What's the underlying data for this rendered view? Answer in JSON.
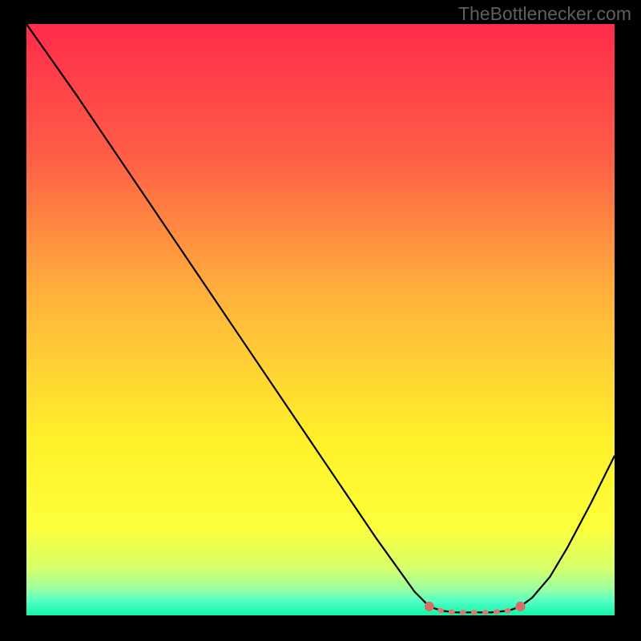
{
  "watermark": "TheBottlenecker.com",
  "chart_data": {
    "type": "line",
    "title": "",
    "xlabel": "",
    "ylabel": "",
    "xlim": [
      0,
      100
    ],
    "ylim": [
      0,
      100
    ],
    "grid": false,
    "legend": false,
    "background_gradient": {
      "stops": [
        {
          "offset": 0.0,
          "color": "#ff2b4b"
        },
        {
          "offset": 0.22,
          "color": "#ff5d47"
        },
        {
          "offset": 0.46,
          "color": "#ffb23c"
        },
        {
          "offset": 0.7,
          "color": "#fff02a"
        },
        {
          "offset": 0.85,
          "color": "#fcff3a"
        },
        {
          "offset": 0.92,
          "color": "#d6ff6b"
        },
        {
          "offset": 0.955,
          "color": "#9bffa0"
        },
        {
          "offset": 0.977,
          "color": "#4fffc6"
        },
        {
          "offset": 1.0,
          "color": "#10f5a7"
        }
      ]
    },
    "series": [
      {
        "name": "bottleneck-curve",
        "color": "#000000",
        "x": [
          0.0,
          8.5,
          17.0,
          25.5,
          34.0,
          42.5,
          51.0,
          59.5,
          66.0,
          68.5,
          70.5,
          73.0,
          76.0,
          79.0,
          82.0,
          84.0,
          86.0,
          89.0,
          92.0,
          96.0,
          100.0
        ],
        "y": [
          100.0,
          88.0,
          75.5,
          63.0,
          50.5,
          38.0,
          25.5,
          13.0,
          4.0,
          1.5,
          0.8,
          0.5,
          0.5,
          0.5,
          0.8,
          1.5,
          3.0,
          6.5,
          11.5,
          19.0,
          27.0
        ]
      }
    ],
    "highlight": {
      "name": "optimal-zone",
      "color": "#e2766f",
      "cap_color": "#d86d67",
      "x": [
        68.5,
        70.5,
        73.0,
        76.0,
        79.0,
        82.0,
        84.0
      ],
      "y": [
        1.5,
        0.8,
        0.5,
        0.5,
        0.5,
        0.8,
        1.5
      ]
    }
  }
}
